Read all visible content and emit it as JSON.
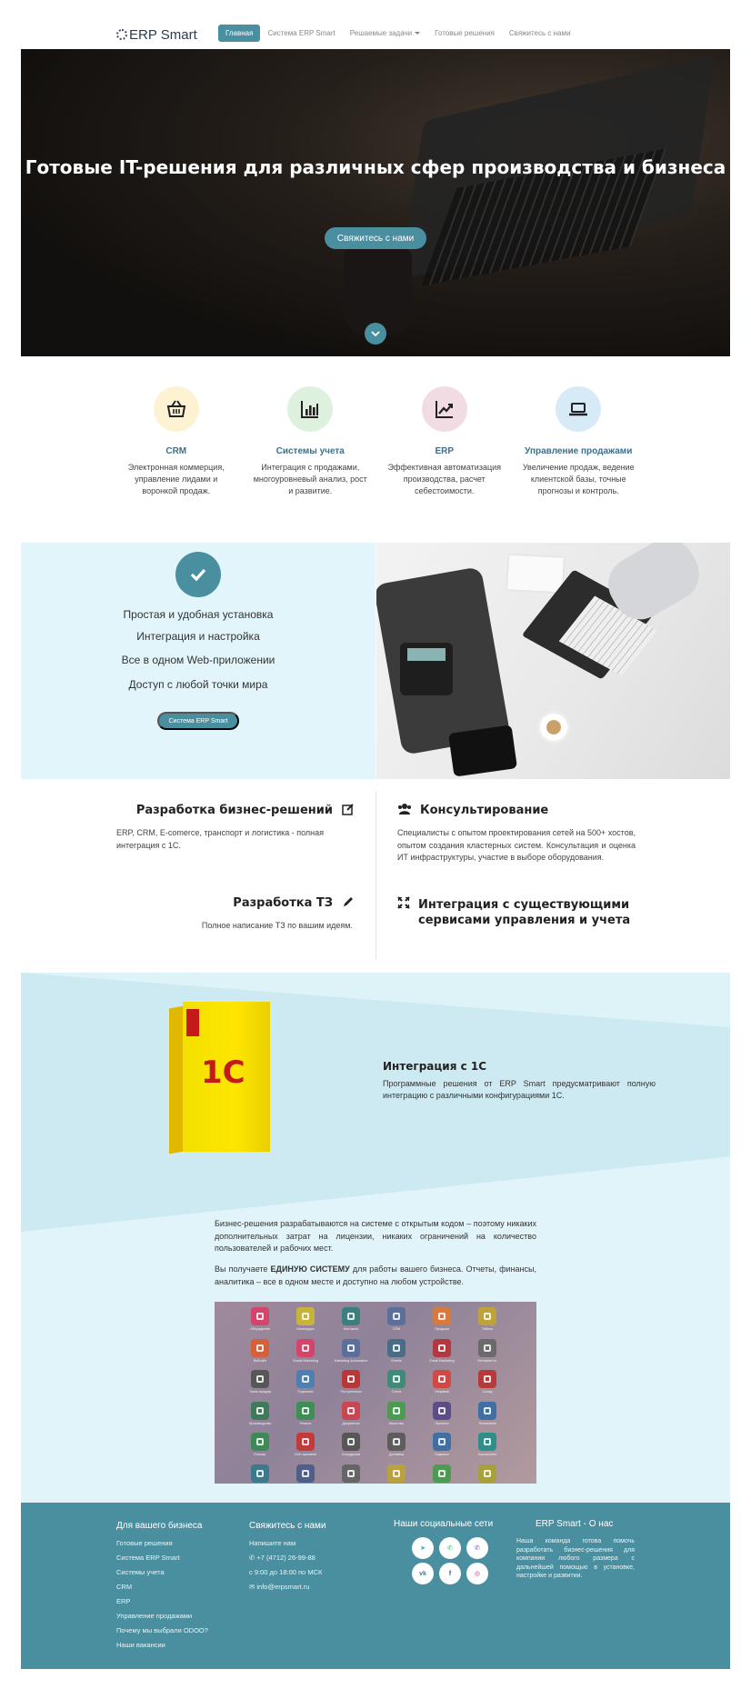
{
  "nav": {
    "logo": "ERP Smart",
    "links": [
      {
        "label": "Главная",
        "active": true
      },
      {
        "label": "Система ERP Smart",
        "active": false
      },
      {
        "label": "Решаемые задачи",
        "active": false,
        "dropdown": true
      },
      {
        "label": "Готовые решения",
        "active": false
      },
      {
        "label": "Свяжитесь с нами",
        "active": false
      }
    ]
  },
  "hero": {
    "title": "Готовые IT-решения для различных сфер производства и бизнеса",
    "button": "Свяжитесь с нами"
  },
  "features": [
    {
      "icon": "basket-icon",
      "color": "#fdf3d3",
      "title": "CRM",
      "text": "Электронная коммерция, управление лидами и воронкой продаж."
    },
    {
      "icon": "bar-chart-icon",
      "color": "#ddf1de",
      "title": "Системы учета",
      "text": "Интеграция с продажами, многоуровневый анализ, рост и развитие."
    },
    {
      "icon": "line-chart-icon",
      "color": "#f2dce4",
      "title": "ERP",
      "text": "Эффективная автоматизация производства, расчет себестоимости."
    },
    {
      "icon": "laptop-icon",
      "color": "#d6ebf7",
      "title": "Управление продажами",
      "text": "Увеличение продаж, ведение клиентской базы, точные прогнозы и контроль."
    }
  ],
  "benefits": {
    "lines": [
      "Простая и удобная установка",
      "Интеграция и настройка",
      "Все в одном Web-приложении",
      "Доступ с любой точки мира"
    ],
    "button": "Система ERP Smart"
  },
  "services": {
    "dev_title": "Разработка бизнес-решений",
    "dev_text": "ERP, CRM, E-comerce, транспорт и логистика - полная интеграция с 1С.",
    "spec_title": "Разработка ТЗ",
    "spec_text": "Полное написание ТЗ  по вашим идеям.",
    "consult_title": "Консультирование",
    "consult_text": "Специалисты с опытом проектирования сетей на 500+ хостов, опытом создания кластерных систем. Консультация и оценка ИТ инфраструктуры, участие в выборе оборудования.",
    "integr_title_1": "Интеграция с существующими",
    "integr_title_2": "сервисами управления и учета"
  },
  "c1": {
    "box_logo": "1С",
    "title": "Интеграция с 1С",
    "text": "Программные решения от ERP Smart предусматривают полную интеграцию с различными конфигурациями 1С.",
    "para1": "Бизнес-решения разрабатываются на системе с открытым кодом – поэтому никаких дополнительных затрат на лицензии, никаких ограничений на количество пользователей и рабочих мест.",
    "para2_a": "Вы получаете ",
    "para2_b": "ЕДИНУЮ СИСТЕМУ",
    "para2_c": " для работы вашего бизнеса. Отчеты, финансы, аналитика – все в одном месте и доступно на любом устройстве.",
    "apps": [
      {
        "label": "Обсуждение",
        "color": "#d3456b"
      },
      {
        "label": "Календарь",
        "color": "#c8b43a"
      },
      {
        "label": "Контакты",
        "color": "#3d7f7f"
      },
      {
        "label": "CRM",
        "color": "#5b6f9a"
      },
      {
        "label": "Продажи",
        "color": "#d77a3e"
      },
      {
        "label": "Табель",
        "color": "#c0a23b"
      },
      {
        "label": "Вебсайт",
        "color": "#d5603a"
      },
      {
        "label": "Social Marketing",
        "color": "#d4456b"
      },
      {
        "label": "Marketing Automation",
        "color": "#5b6f9a"
      },
      {
        "label": "Events",
        "color": "#4a6d86"
      },
      {
        "label": "Email Marketing",
        "color": "#b3383f"
      },
      {
        "label": "Интернет-м.",
        "color": "#6a6a6a"
      },
      {
        "label": "Точка продаж",
        "color": "#575757"
      },
      {
        "label": "Подписка",
        "color": "#4f7fb0"
      },
      {
        "label": "Поступления",
        "color": "#b83838"
      },
      {
        "label": "Счета",
        "color": "#3f8a79"
      },
      {
        "label": "Helpdesk",
        "color": "#d04a45"
      },
      {
        "label": "Склад",
        "color": "#b73a3a"
      },
      {
        "label": "Производство",
        "color": "#417a5a"
      },
      {
        "label": "Ремонт",
        "color": "#3f8f54"
      },
      {
        "label": "Документы",
        "color": "#c84750"
      },
      {
        "label": "Качество",
        "color": "#4d9a52"
      },
      {
        "label": "Проекты",
        "color": "#5c4d86"
      },
      {
        "label": "Timesheets",
        "color": "#3f6fa3"
      },
      {
        "label": "Планир.",
        "color": "#3d8a58"
      },
      {
        "label": "Учёт времени",
        "color": "#c43a3a"
      },
      {
        "label": "Сотрудники",
        "color": "#575757"
      },
      {
        "label": "Доставка",
        "color": "#5d5d5d"
      },
      {
        "label": "Подписи",
        "color": "#3f6fa3"
      },
      {
        "label": "Лояльность",
        "color": "#2f8f88"
      },
      {
        "label": "Сотрудники",
        "color": "#3b7a8a"
      },
      {
        "label": "Набор",
        "color": "#4f5f8a"
      },
      {
        "label": "Отпуск",
        "color": "#656565"
      },
      {
        "label": "Оценка",
        "color": "#b9a23e"
      },
      {
        "label": "Расходы",
        "color": "#4f9a52"
      },
      {
        "label": "Обед",
        "color": "#a8a038"
      }
    ]
  },
  "footer": {
    "col1_title": "Для вашего бизнеса",
    "col1_items": [
      "Готовые решения",
      "Система  ERP Smart",
      "Системы учета",
      "CRM",
      "ERP",
      "Управление продажами",
      "Почему мы выбрали ODOO?",
      "Наши вакансии"
    ],
    "col2_title": "Свяжитесь с нами",
    "col2_items": [
      "Напишите нам",
      "+7 (4712) 26-99-88",
      "с 9:00 до 18:00 по МСК",
      "info@erpsmart.ru"
    ],
    "col3_title": "Наши социальные сети",
    "socials": [
      {
        "icon": "telegram-icon",
        "glyph": "➤",
        "color": "#2aa3d8"
      },
      {
        "icon": "whatsapp-icon",
        "glyph": "✆",
        "color": "#36c45a"
      },
      {
        "icon": "viber-icon",
        "glyph": "✆",
        "color": "#7a55c8"
      },
      {
        "icon": "vk-icon",
        "glyph": "vk",
        "color": "#4b76a8"
      },
      {
        "icon": "facebook-icon",
        "glyph": "f",
        "color": "#3b5998"
      },
      {
        "icon": "instagram-icon",
        "glyph": "◎",
        "color": "#c3397e"
      }
    ],
    "col4_title_a": "ERP Smart",
    "col4_title_sep": "-",
    "col4_title_b": "О нас",
    "about": "Наша команда готова помочь разработать бизнес-решения для компании любого размера с дальнейшей помощью в установке, настройке и развитии."
  }
}
